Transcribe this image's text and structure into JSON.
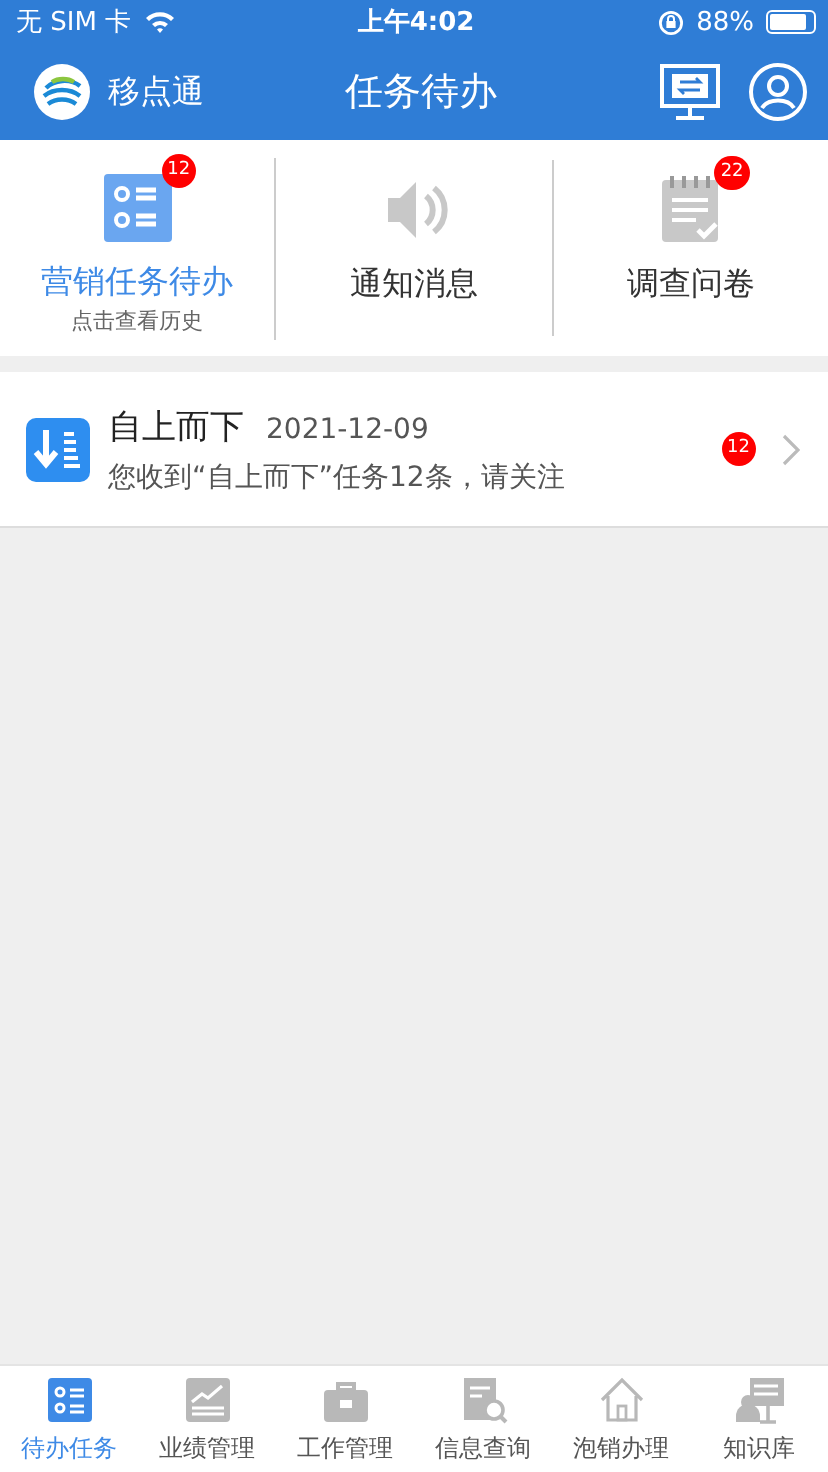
{
  "status_bar": {
    "carrier": "无 SIM 卡",
    "time": "上午4:02",
    "battery": "88%"
  },
  "header": {
    "app_name": "移点通",
    "title": "任务待办"
  },
  "categories": [
    {
      "label": "营销任务待办",
      "sublabel": "点击查看历史",
      "badge": "12",
      "selected": true
    },
    {
      "label": "通知消息",
      "selected": false
    },
    {
      "label": "调查问卷",
      "badge": "22",
      "selected": false
    }
  ],
  "tasks": [
    {
      "title": "自上而下",
      "date": "2021-12-09",
      "message": "您收到“自上而下”任务12条，请关注",
      "badge": "12"
    }
  ],
  "tab_bar": [
    {
      "label": "待办任务",
      "selected": true
    },
    {
      "label": "业绩管理",
      "selected": false
    },
    {
      "label": "工作管理",
      "selected": false
    },
    {
      "label": "信息查询",
      "selected": false
    },
    {
      "label": "泡销办理",
      "selected": false
    },
    {
      "label": "知识库",
      "selected": false
    }
  ]
}
